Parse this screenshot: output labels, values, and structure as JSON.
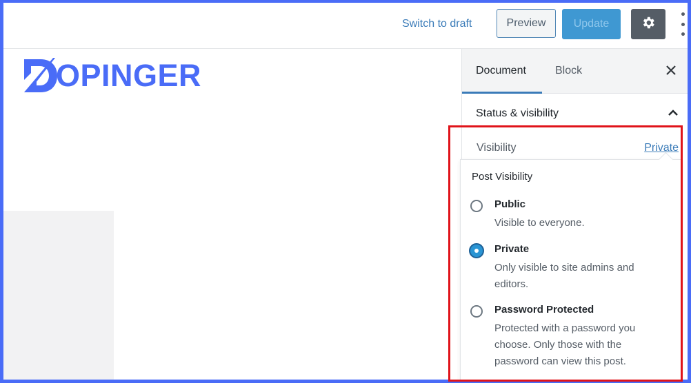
{
  "header": {
    "switch_to_draft": "Switch to draft",
    "preview": "Preview",
    "update": "Update",
    "settings_icon": "gear-icon",
    "more_icon": "vertical-ellipsis-icon"
  },
  "content": {
    "logo_text": "OPINGER",
    "logo_mark": "D"
  },
  "sidebar": {
    "tabs": [
      {
        "label": "Document",
        "active": true
      },
      {
        "label": "Block",
        "active": false
      }
    ],
    "close_icon": "close-icon",
    "panel": {
      "title": "Status & visibility",
      "expanded": true,
      "visibility_label": "Visibility",
      "visibility_value": "Private"
    },
    "popover": {
      "title": "Post Visibility",
      "options": [
        {
          "label": "Public",
          "description": "Visible to everyone.",
          "selected": false
        },
        {
          "label": "Private",
          "description": "Only visible to site admins and editors.",
          "selected": true
        },
        {
          "label": "Password Protected",
          "description": "Protected with a password you choose. Only those with the password can view this post.",
          "selected": false
        }
      ]
    }
  },
  "colors": {
    "frame": "#4a6cf7",
    "accent": "#3a7bb8",
    "update_button": "#3f98d2",
    "settings_button": "#555d66",
    "highlight": "#e0131a"
  }
}
